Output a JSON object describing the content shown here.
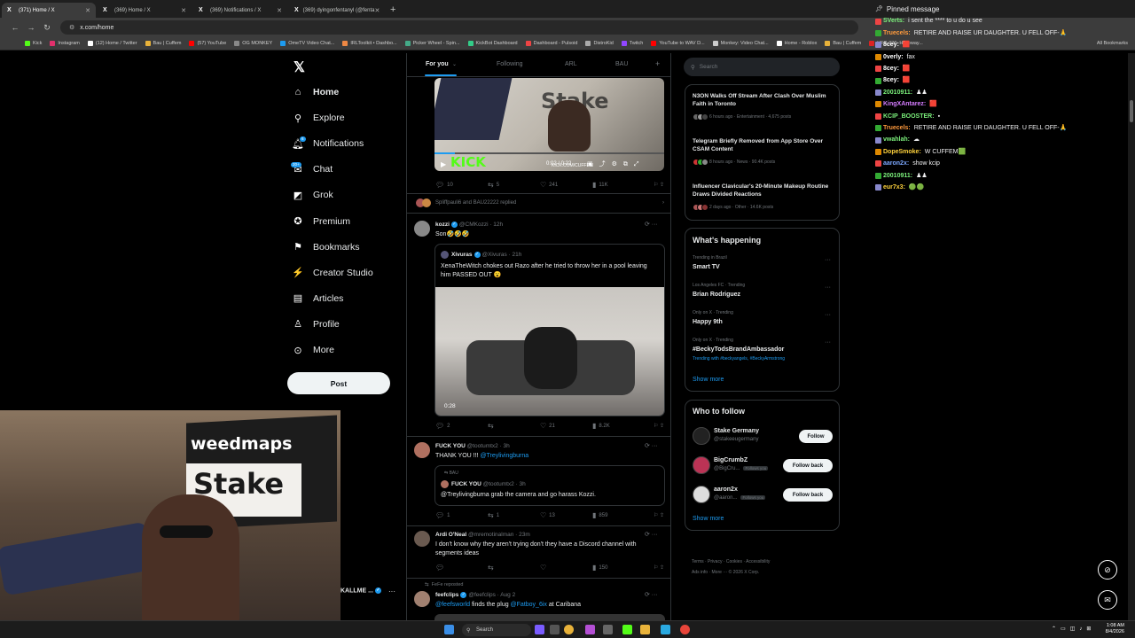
{
  "browser": {
    "tabs": [
      {
        "title": "(371) Home / X",
        "active": true
      },
      {
        "title": "(369) Home / X",
        "active": false
      },
      {
        "title": "(369) Notifications / X",
        "active": false
      },
      {
        "title": "(369) dyingonfentanyl (@fenta",
        "active": false
      }
    ],
    "url": "x.com/home",
    "bookmarks": [
      "Kick",
      "Instagram",
      "(12) Home / Twitter",
      "Bau | Cuffem",
      "(57) YouTube",
      "OG MONKEY",
      "OmeTV Video Chat...",
      "IRLToolkit • Dashbo...",
      "Picker Wheel - Spin...",
      "KickBot Dashboard",
      "Dashboard - Pulsoid",
      "DistroKid",
      "Twitch",
      "YouTube to WAV D...",
      "Monkey: Video Chat...",
      "Home - Roblox",
      "Bau | Cuffem",
      "UFC 326: Holloway..."
    ],
    "all_bookmarks": "All Bookmarks"
  },
  "nav": {
    "items": [
      {
        "label": "Home",
        "icon": "home-icon",
        "glyph": "⌂"
      },
      {
        "label": "Explore",
        "icon": "search-icon",
        "glyph": "⚲"
      },
      {
        "label": "Notifications",
        "icon": "bell-icon",
        "glyph": "🔔︎"
      },
      {
        "label": "Chat",
        "icon": "chat-icon",
        "glyph": "✉"
      },
      {
        "label": "Grok",
        "icon": "grok-icon",
        "glyph": "◩"
      },
      {
        "label": "Premium",
        "icon": "premium-icon",
        "glyph": "✪"
      },
      {
        "label": "Bookmarks",
        "icon": "bookmark-icon",
        "glyph": "⚑"
      },
      {
        "label": "Creator Studio",
        "icon": "creator-studio-icon",
        "glyph": "⚡"
      },
      {
        "label": "Articles",
        "icon": "articles-icon",
        "glyph": "▤"
      },
      {
        "label": "Profile",
        "icon": "profile-icon",
        "glyph": "♙"
      },
      {
        "label": "More",
        "icon": "more-icon",
        "glyph": "⊙"
      }
    ],
    "notif_badge": "6",
    "chat_badge": "20+",
    "post_label": "Post",
    "account_name": "KALLME ..."
  },
  "feed": {
    "tabs": [
      "For you",
      "Following",
      "ARL",
      "BAU"
    ],
    "video1": {
      "time": "0:02 / 0:22",
      "stake_text": "Stake",
      "kick_text": "KICK",
      "kick_url": "KICK.COM/CUFFEM"
    },
    "t0_actions": {
      "reply": "10",
      "repost": "5",
      "like": "241",
      "views": "11K"
    },
    "replied": "Spliffpauli6 and BAU22222 replied",
    "t1": {
      "name": "kozzi",
      "handle": "@CMKozzi · 12h",
      "text": "Son🤣🤣🤣",
      "quote_name": "Xivuras",
      "quote_handle": "@Xivuras · 21h",
      "quote_text": "XenaTheWitch chokes out Razo after he tried to throw her in a pool leaving him PASSED OUT 😮",
      "duration": "0:28",
      "actions": {
        "reply": "2",
        "repost": "",
        "like": "21",
        "views": "8.2K"
      }
    },
    "t2": {
      "name": "FUCK YOU",
      "handle": "@tootumtx2 · 3h",
      "text": "THANK YOU !!! ",
      "mention": "@Treylivingburna",
      "quote_ctx": "BAU",
      "quote_name": "FUCK YOU",
      "quote_handle": "@tootumtx2 · 3h",
      "quote_text": "@Treylivingburna grab the camera and go harass Kozzi.",
      "actions": {
        "reply": "1",
        "repost": "1",
        "like": "13",
        "views": "859"
      }
    },
    "t3": {
      "name": "Ardi O'Neal",
      "handle": "@mremotinalman · 23m",
      "text": "I don't know why they aren't trying don't they have a Discord channel with segments ideas",
      "actions": {
        "reply": "",
        "repost": "",
        "like": "",
        "views": "150"
      }
    },
    "t4": {
      "ctx": "FeFe reposted",
      "name": "feefclips",
      "handle": "@feefclips · Aug 2",
      "text_link1": "@feefsworld",
      "text_mid": " finds the plug ",
      "text_link2": "@Fatboy_6ix",
      "text_end": " at Caribana"
    }
  },
  "right": {
    "search_placeholder": "Search",
    "news": [
      {
        "title": "N3ON Walks Off Stream After Clash Over Muslim Faith in Toronto",
        "meta": "6 hours ago · Entertainment · 4,675 posts"
      },
      {
        "title": "Telegram Briefly Removed from App Store Over CSAM Content",
        "meta": "8 hours ago · News · 90.4K posts"
      },
      {
        "title": "Influencer Clavicular's 20-Minute Makeup Routine Draws Divided Reactions",
        "meta": "2 days ago · Other · 14.6K posts"
      }
    ],
    "happening_title": "What's happening",
    "trends": [
      {
        "ctx": "Trending in Brazil",
        "name": "Smart TV",
        "extra": ""
      },
      {
        "ctx": "Los Angeles FC · Trending",
        "name": "Brian Rodriguez",
        "extra": ""
      },
      {
        "ctx": "Only on X · Trending",
        "name": "Happy 9th",
        "extra": ""
      },
      {
        "ctx": "Only on X · Trending",
        "name": "#BeckyTodsBrandAmbassador",
        "extra": "Trending with #beckyangels, #BeckyArmstrong"
      }
    ],
    "show_more": "Show more",
    "wtf_title": "Who to follow",
    "wtf": [
      {
        "name": "Stake Germany",
        "handle": "@stakeeugermany",
        "btn": "Follow",
        "follows_you": ""
      },
      {
        "name": "BigCrumbZ",
        "handle": "@BigCru...",
        "btn": "Follow back",
        "follows_you": "Follows you"
      },
      {
        "name": "aaron2x",
        "handle": "@aaron...",
        "btn": "Follow back",
        "follows_you": "Follows you"
      }
    ],
    "footer_line1": "Terms · Privacy · Cookies · Accessibility",
    "footer_line2": "Ads info · More ··· © 2026 X Corp."
  },
  "chat": {
    "pinned": "Pinned message",
    "lines": [
      {
        "user": "SVerts:",
        "msg": "i sent the **** to u do u see",
        "color": "#7cf17c"
      },
      {
        "user": "Truecels:",
        "msg": "RETIRE AND RAISE UR DAUGHTER. U FELL OFF-🙏",
        "color": "#ff9a3c"
      },
      {
        "user": "8cey:",
        "msg": "🟥",
        "color": "#ffffff"
      },
      {
        "user": "0verly:",
        "msg": "fax",
        "color": "#ffffff"
      },
      {
        "user": "8cey:",
        "msg": "🟥",
        "color": "#ffffff"
      },
      {
        "user": "8cey:",
        "msg": "🟥",
        "color": "#ffffff"
      },
      {
        "user": "20010911:",
        "msg": "♟♟",
        "color": "#7cf17c"
      },
      {
        "user": "KingXAntarez:",
        "msg": "🟥",
        "color": "#d57cff"
      },
      {
        "user": "KCIP_BOOSTER:",
        "msg": "▪",
        "color": "#7cf17c"
      },
      {
        "user": "Truecels:",
        "msg": "RETIRE AND RAISE UR DAUGHTER. U FELL OFF-🙏",
        "color": "#ff9a3c"
      },
      {
        "user": "vwahlah:",
        "msg": "☁",
        "color": "#7cf17c"
      },
      {
        "user": "DopeSmoke:",
        "msg": "W CUFFEM🟩",
        "color": "#ffd23c"
      },
      {
        "user": "aaron2x:",
        "msg": "show kcip",
        "color": "#7ca8ff"
      },
      {
        "user": "20010911:",
        "msg": "♟♟",
        "color": "#7cf17c"
      },
      {
        "user": "eur7x3:",
        "msg": "🟢🟢",
        "color": "#ffd23c"
      }
    ]
  },
  "webcam": {
    "brand1": "weedmaps",
    "brand2": "Stake"
  },
  "taskbar": {
    "search": "Search",
    "time": "1:08 AM",
    "date": "8/4/2026"
  },
  "colors": {
    "accent": "#1d9bf0",
    "bg": "#000000",
    "border": "#2f3336",
    "muted": "#71767b"
  }
}
